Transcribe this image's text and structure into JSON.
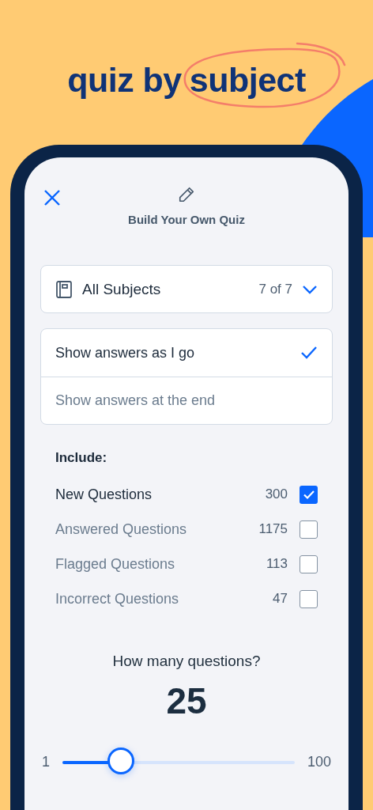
{
  "headline": {
    "text": "quiz by",
    "highlight": "subject"
  },
  "header": {
    "title": "Build Your Own Quiz"
  },
  "subject_picker": {
    "label": "All Subjects",
    "count": "7 of 7"
  },
  "answer_modes": [
    {
      "label": "Show answers as I go",
      "selected": true
    },
    {
      "label": "Show answers at the end",
      "selected": false
    }
  ],
  "include": {
    "title": "Include:",
    "items": [
      {
        "label": "New Questions",
        "count": "300",
        "checked": true
      },
      {
        "label": "Answered Questions",
        "count": "1175",
        "checked": false
      },
      {
        "label": "Flagged Questions",
        "count": "113",
        "checked": false
      },
      {
        "label": "Incorrect Questions",
        "count": "47",
        "checked": false
      }
    ]
  },
  "question_count": {
    "prompt": "How many questions?",
    "value": "25",
    "min": "1",
    "max": "100",
    "level": 0.25
  }
}
